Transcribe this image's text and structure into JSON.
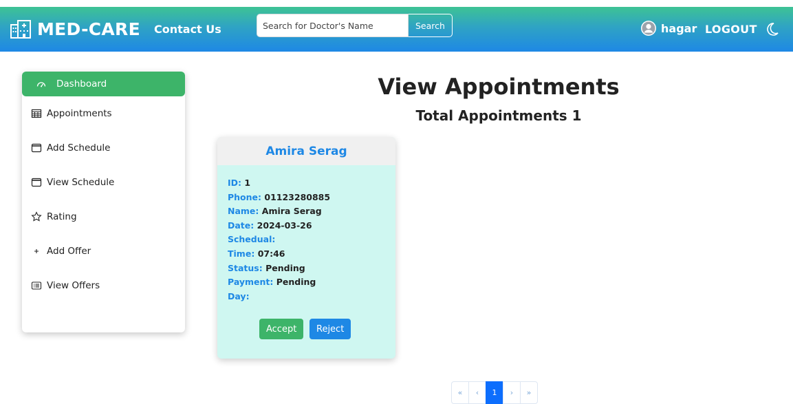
{
  "navbar": {
    "brand": "MED-CARE",
    "contact": "Contact Us",
    "search_placeholder": "Search for Doctor's Name",
    "search_button": "Search",
    "username": "hagar",
    "logout": "LOGOUT"
  },
  "sidebar": {
    "items": [
      {
        "label": "Dashboard",
        "icon": "dashboard-icon",
        "active": true
      },
      {
        "label": "Appointments",
        "icon": "table-icon"
      },
      {
        "label": "Add Schedule",
        "icon": "calendar-icon"
      },
      {
        "label": "View Schedule",
        "icon": "calendar-icon"
      },
      {
        "label": "Rating",
        "icon": "star-icon"
      },
      {
        "label": "Add Offer",
        "icon": "plus-icon"
      },
      {
        "label": "View Offers",
        "icon": "list-card-icon"
      }
    ]
  },
  "main": {
    "title": "View Appointments",
    "total": "Total Appointments 1"
  },
  "appointment": {
    "header_name": "Amira Serag",
    "id_label": "ID:",
    "id": "1",
    "phone_label": "Phone:",
    "phone": "01123280885",
    "name_label": "Name:",
    "name": "Amira Serag",
    "date_label": "Date:",
    "date": "2024-03-26",
    "schedule_label": "Schedual:",
    "schedule": "",
    "time_label": "Time:",
    "time": "07:46",
    "status_label": "Status:",
    "status": "Pending",
    "payment_label": "Payment:",
    "payment": "Pending",
    "day_label": "Day:",
    "day": "",
    "accept": "Accept",
    "reject": "Reject"
  },
  "pagination": {
    "first": "«",
    "prev": "‹",
    "current": "1",
    "next": "›",
    "last": "»"
  },
  "colors": {
    "nav_gradient": [
      "#3ec394",
      "#1e88e5"
    ],
    "active_green": "#3db469",
    "accent_blue": "#1e88e5",
    "card_bg": "#cff7f1"
  }
}
